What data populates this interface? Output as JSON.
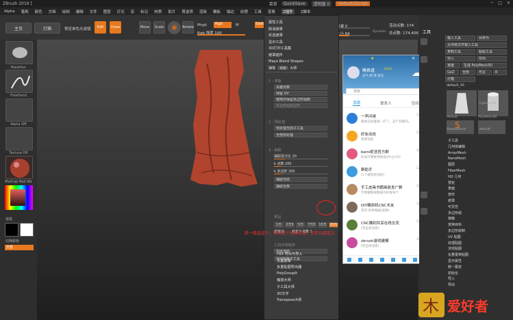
{
  "titlebar": {
    "app": "ZBrush 2019 [",
    "items": [
      "菜单",
      "QuickSave",
      "透明度 0",
      "DefaultZScript",
      "AC",
      "0%"
    ],
    "quicksave": "QuickSave",
    "see_through": "透明度 0",
    "menus": "菜单",
    "script": "DefaultZScript"
  },
  "menubar": [
    "Alpha",
    "笔刷",
    "颜色",
    "文档",
    "绘制",
    "编辑",
    "文件",
    "图层",
    "灯光",
    "宏",
    "标记",
    "材质",
    "影片",
    "首选项",
    "渲染",
    "模板",
    "描边",
    "纹理",
    "工具",
    "变换",
    "Z插件",
    "Z脚本"
  ],
  "menubar_active": "Z插件",
  "shelf": {
    "home": "主页",
    "lightbox": "灯箱",
    "preview": "预览单色光滤镜",
    "edit": "Edit",
    "draw": "Draw",
    "move": "Move",
    "scale": "Scale",
    "rotate": "Rotate",
    "mrgb": "Mrgb",
    "rgb": "Rgb",
    "m": "M",
    "zadd": "Zadd",
    "zsub": "Zsub",
    "rgb_intensity": "Rgb 强度 100",
    "focal_label": "焦点衰减 0",
    "draw_size": "绘制大小 64",
    "dynamic": "Dynamic",
    "active_points": "活动点数: 174",
    "total_points": "总点数: 174,406",
    "z_intensity": "Z 强度"
  },
  "lefttray": {
    "brush": "MaskPen",
    "stroke": "FreeHand",
    "alpha": "Alpha Off",
    "texture": "Texture Off",
    "material": "MatCap Red Wa",
    "gradient": "渐变",
    "switch_color": "切换颜色",
    "alternate": "交替"
  },
  "zmenu": {
    "items": [
      "属性工具",
      "取消遮罩",
      "反选遮罩",
      "显示工具",
      "3D打印工具集",
      "遮罩插件",
      "Maya Blend Shapes",
      "抽取（减面）大师"
    ],
    "section1": "1 - 准备",
    "s1_items": [
      "关键点数",
      "保留 UV",
      "使用并保留多边形组制",
      "多边形组和边界"
    ],
    "section2": "2 - 预处理",
    "s2_items": [
      "预处理当前子工具",
      "全部预处理"
    ],
    "section3": "3 - 抽取",
    "s3_slider1": "抽取百分比 20",
    "s3_slider2": "k 点数 200",
    "s3_slider3": "k 多边形 200",
    "s3_items": [
      "抽取当前",
      "抽取全部"
    ],
    "presets_label": "预设",
    "fractions": [
      "1万",
      "2万5",
      "5万",
      "7万5",
      "15万",
      "25万"
    ],
    "custom": "自定义",
    "custom_count": "自定义点数 1",
    "section4": "工具实用程序",
    "export_current": "导出当前",
    "export_all": "导出所有子工具",
    "lower_items": [
      "FBX 导出与导入",
      "文集遮罩",
      "多重贴图导出器",
      "PolyGroupIt",
      "缩放大师",
      "子工具大师",
      "3D文字",
      "Transpose大师"
    ]
  },
  "qq": {
    "username": "曦君道",
    "vip": "LV16",
    "status": "天气 阴 转 多云",
    "search": "搜索",
    "tabs": [
      "消息",
      "联系人",
      "空间"
    ],
    "active_tab": "消息",
    "rows": [
      {
        "name": "一声问候",
        "msg": "群发信息邀请…打了，这个您能吗。",
        "time": "12:54",
        "badge": "1",
        "color": "#2b7fd6"
      },
      {
        "name": "好友动态",
        "msg": "有新动态",
        "time": "12:54",
        "badge": "",
        "color": "#f5a623"
      },
      {
        "name": "beini昵咨官方群",
        "msg": "的总行需要领导选VIP之UV2",
        "time": "12:53",
        "badge": "9",
        "color": "#e25b7d"
      },
      {
        "name": "群助手",
        "msg": "[1个群有新消息]",
        "time": "12:52",
        "badge": "",
        "color": "#3e9bdf"
      },
      {
        "name": "手工皮具书籍画册发广群",
        "msg": "不锈钢玻璃我来为你发布个",
        "time": "12:37",
        "badge": "1",
        "color": "#b78a62"
      },
      {
        "name": "DIY雕刻机CNC木友",
        "msg": "定印·杂草根据(就像)",
        "time": "12:38",
        "badge": "",
        "color": "#7d6b5a"
      },
      {
        "name": "CNC雕刻共享在线交流",
        "msg": "[有全体消息]",
        "time": "12:34",
        "badge": "",
        "color": "#5a7f3a"
      },
      {
        "name": "zbrush游戏建模",
        "msg": "[有全体消息]",
        "time": "12:20",
        "badge": "",
        "color": "#c94b9d"
      }
    ]
  },
  "rightcol": {
    "title": "工具",
    "top_buttons": [
      "载入工具",
      "另存为",
      "从项目文件载入工具",
      "复制工具",
      "粘贴工具",
      "导入",
      "导出",
      "克隆",
      "生成 PolyMesh3D",
      "GoZ",
      "全部",
      "可见",
      "R",
      "灯箱",
      "工具"
    ],
    "tool_name": "default_41",
    "thumbs": [
      "default",
      "Cylinder3D",
      "PolyMesh3D",
      "SimpleBrush",
      "default"
    ],
    "list": [
      "子工具",
      "几何体编辑",
      "ArrayMesh",
      "NanoMesh",
      "图层",
      "FiberMesh",
      "HD 几何",
      "预览",
      "表面",
      "变形",
      "遮罩",
      "可见性",
      "多边形组",
      "接触",
      "变换目标",
      "多边形绘制",
      "UV 贴图",
      "纹理贴图",
      "法线贴图",
      "矢量置换贴图",
      "显示属性",
      "统一蒙皮",
      "初始化",
      "导入",
      "导出"
    ]
  },
  "overlay": {
    "red_text": "我一般选这个，中间这个比较合适，也可以自定义"
  },
  "watermark": {
    "text": "爱好者"
  },
  "colors": {
    "accent": "#e8781e",
    "red_overlay": "#ff2020",
    "qq_blue": "#1a8ad4",
    "sculpt": "#b0442e"
  }
}
